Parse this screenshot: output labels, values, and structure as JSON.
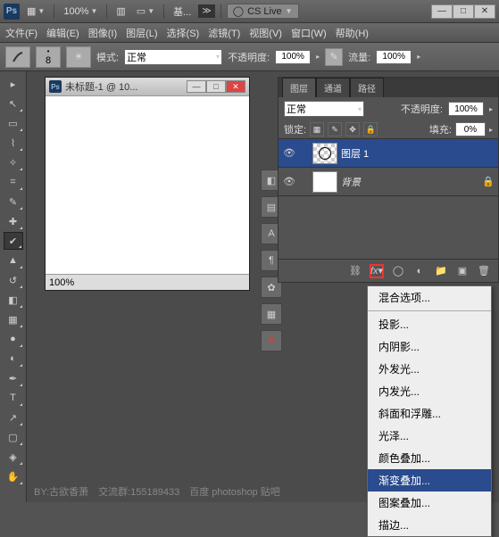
{
  "titlebar": {
    "zoom": "100%",
    "essential": "基...",
    "cslive": "CS Live"
  },
  "menubar": [
    "文件(F)",
    "编辑(E)",
    "图像(I)",
    "图层(L)",
    "选择(S)",
    "滤镜(T)",
    "视图(V)",
    "窗口(W)",
    "帮助(H)"
  ],
  "optbar": {
    "brush_size": "8",
    "mode_label": "模式:",
    "mode_value": "正常",
    "opacity_label": "不透明度:",
    "opacity_value": "100%",
    "flow_label": "流量:",
    "flow_value": "100%"
  },
  "document": {
    "title": "未标题-1 @ 10...",
    "zoom": "100%"
  },
  "panel": {
    "tabs": [
      "图层",
      "通道",
      "路径"
    ],
    "blend_label": "正常",
    "opacity_label": "不透明度:",
    "opacity_value": "100%",
    "lock_label": "锁定:",
    "fill_label": "填充:",
    "fill_value": "0%",
    "layers": [
      {
        "name": "图层 1",
        "selected": true,
        "kind": "shape"
      },
      {
        "name": "背景",
        "selected": false,
        "kind": "bg",
        "locked": true
      }
    ]
  },
  "fx_menu": [
    "混合选项...",
    "投影...",
    "内阴影...",
    "外发光...",
    "内发光...",
    "斜面和浮雕...",
    "光泽...",
    "颜色叠加...",
    "渐变叠加...",
    "图案叠加...",
    "描边..."
  ],
  "fx_selected": "渐变叠加...",
  "watermark": "BY:古欲香萧　交流群:155189433　百度 photoshop 贴吧"
}
